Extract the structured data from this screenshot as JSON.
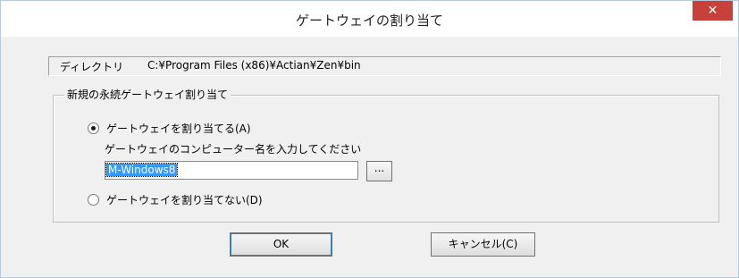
{
  "window": {
    "title": "ゲートウェイの割り当て",
    "close_glyph": "✕"
  },
  "directory": {
    "label": "ディレクトリ",
    "value": "C:¥Program Files (x86)¥Actian¥Zen¥bin"
  },
  "group": {
    "title": "新規の永続ゲートウェイ割り当て",
    "assign_label": "ゲートウェイを割り当てる(A)",
    "assign_selected": true,
    "prompt": "ゲートウェイのコンピューター名を入力してください",
    "computer_name": "M-Windows8",
    "browse_label": "...",
    "no_assign_label": "ゲートウェイを割り当てない(D)",
    "no_assign_selected": false
  },
  "buttons": {
    "ok_label": "OK",
    "cancel_label": "キャンセル(C)"
  },
  "colors": {
    "close_bg": "#c7413a",
    "selection": "#3399ff",
    "dialog_bg": "#f0f0f0"
  }
}
